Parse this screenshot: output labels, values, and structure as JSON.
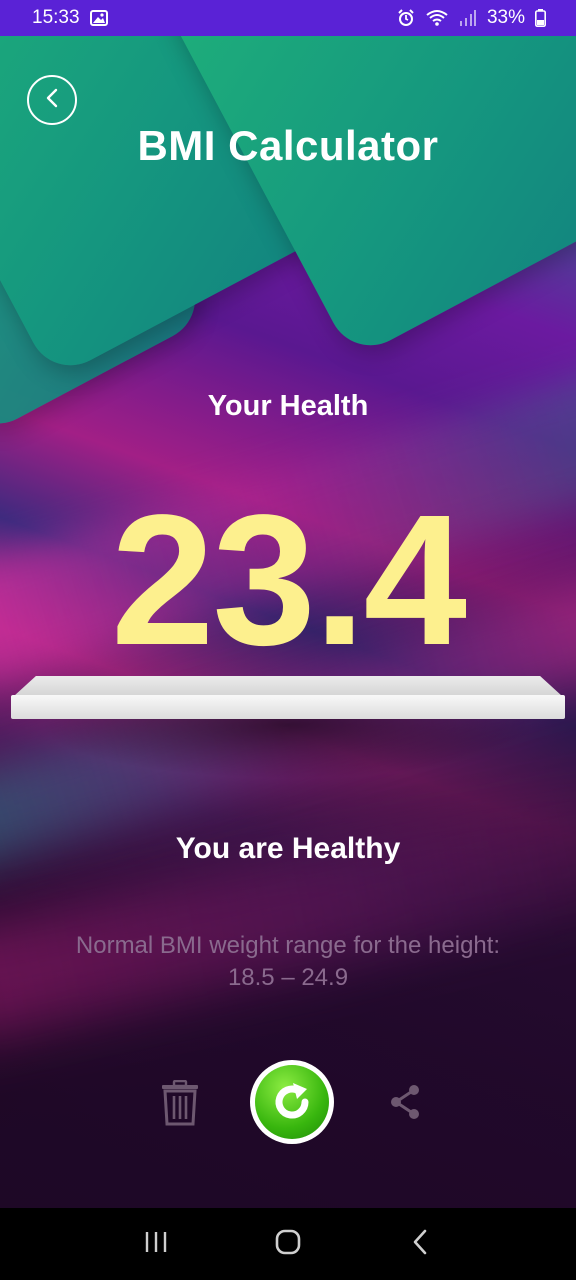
{
  "status_bar": {
    "time": "15:33",
    "battery": "33%",
    "icons": [
      "image-icon",
      "alarm-icon",
      "wifi-icon",
      "signal-icon",
      "battery-icon"
    ]
  },
  "header": {
    "title": "BMI Calculator",
    "back_icon": "chevron-left-icon"
  },
  "result": {
    "label": "Your Health",
    "bmi_value": "23.4",
    "status": "You are Healthy",
    "range_line1": "Normal BMI weight range for the height:",
    "range_line2": "18.5 – 24.9"
  },
  "actions": {
    "icons": [
      "trash-icon",
      "refresh-icon",
      "share-icon"
    ]
  },
  "nav_bar": {
    "icons": [
      "recents-icon",
      "home-icon",
      "back-icon"
    ]
  },
  "colors": {
    "accent_green": "#1fa57f",
    "bmi_yellow": "#fdf08e",
    "status_bar": "#5a22d6"
  }
}
